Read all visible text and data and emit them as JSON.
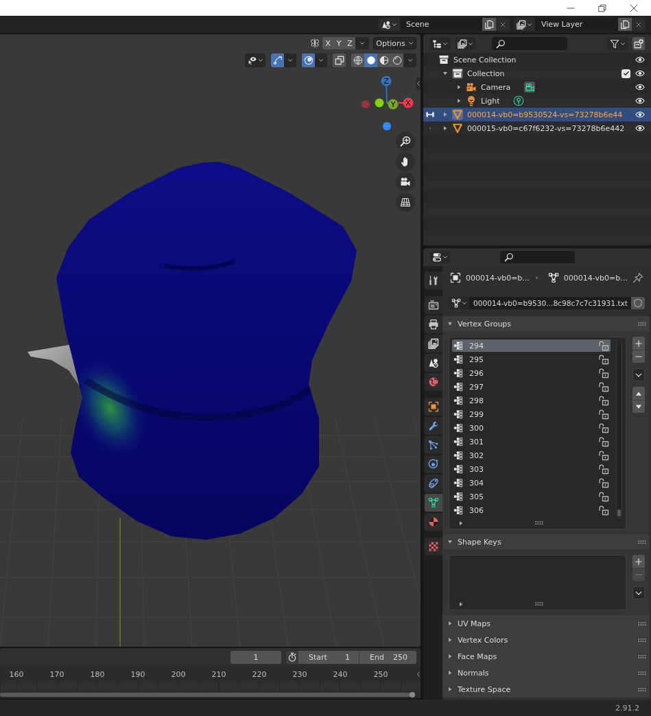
{
  "top_bar": {
    "scene": "Scene",
    "view_layer": "View Layer"
  },
  "viewport": {
    "mirror_axes": [
      {
        "label": "X",
        "selected": false
      },
      {
        "label": "Y",
        "selected": false
      },
      {
        "label": "Z",
        "selected": false
      }
    ],
    "options": "Options",
    "toggles": [
      {
        "kind": "selectability",
        "on": false
      },
      {
        "kind": "gizmos",
        "on": true
      },
      {
        "kind": "overlays",
        "on": true
      },
      {
        "kind": "xray",
        "on": false
      }
    ],
    "shading": [
      {
        "kind": "wireframe",
        "selected": false
      },
      {
        "kind": "solid",
        "selected": true
      },
      {
        "kind": "material",
        "selected": false
      },
      {
        "kind": "rendered",
        "selected": false
      }
    ],
    "gizmo_axes": [
      {
        "kind": "z",
        "label": "Z"
      },
      {
        "kind": "y",
        "label": "Y"
      },
      {
        "kind": "x",
        "label": "X"
      }
    ]
  },
  "timeline": {
    "current_frame": "1",
    "start_label": "Start",
    "start": "1",
    "end_label": "End",
    "end": "250",
    "ruler": [
      "160",
      "170",
      "180",
      "190",
      "200",
      "210",
      "220",
      "230",
      "240",
      "250"
    ]
  },
  "outliner": {
    "tree": [
      {
        "kind": "scene_collection",
        "label": "Scene Collection",
        "selected": false,
        "children": [
          {
            "kind": "collection",
            "label": "Collection",
            "expanded": true,
            "checked": true,
            "selected": false,
            "children": [
              {
                "kind": "camera",
                "label": "Camera",
                "expanded": false,
                "selected": false
              },
              {
                "kind": "light",
                "label": "Light",
                "expanded": false,
                "selected": false
              }
            ]
          },
          {
            "kind": "mesh",
            "label": "000014-vb0=b9530524-vs=73278b6e44",
            "expanded": false,
            "selected": true,
            "in_mode": true
          },
          {
            "kind": "mesh",
            "label": "000015-vb0=c67f6232-vs=73278b6e442",
            "expanded": false,
            "selected": false,
            "in_mode": false
          }
        ]
      }
    ]
  },
  "properties": {
    "tab_groups": [
      [
        {
          "kind": "tool",
          "selected": false
        }
      ],
      [
        {
          "kind": "render",
          "selected": false
        },
        {
          "kind": "output",
          "selected": false
        },
        {
          "kind": "view_layer",
          "selected": false
        },
        {
          "kind": "scene",
          "selected": false
        },
        {
          "kind": "world",
          "selected": false
        }
      ],
      [
        {
          "kind": "object",
          "selected": false
        },
        {
          "kind": "modifiers",
          "selected": false
        },
        {
          "kind": "particles",
          "selected": false
        },
        {
          "kind": "physics",
          "selected": false
        },
        {
          "kind": "constraints",
          "selected": false
        },
        {
          "kind": "data",
          "selected": true
        },
        {
          "kind": "material",
          "selected": false
        }
      ],
      [
        {
          "kind": "texture",
          "selected": false
        }
      ]
    ],
    "breadcrumb": [
      {
        "kind": "object",
        "label": "000014-vb0=b..."
      },
      {
        "kind": "mesh",
        "label": "000014-vb0=b..."
      }
    ],
    "mesh_name": "000014-vb0=b9530...8c98c7c7c31931.txt",
    "panels": [
      {
        "title": "Vertex Groups",
        "expanded": true,
        "items": [
          {
            "name": "294",
            "selected": true,
            "locked": false
          },
          {
            "name": "295",
            "selected": false,
            "locked": false
          },
          {
            "name": "296",
            "selected": false,
            "locked": false
          },
          {
            "name": "297",
            "selected": false,
            "locked": false
          },
          {
            "name": "298",
            "selected": false,
            "locked": false
          },
          {
            "name": "299",
            "selected": false,
            "locked": false
          },
          {
            "name": "300",
            "selected": false,
            "locked": false
          },
          {
            "name": "301",
            "selected": false,
            "locked": false
          },
          {
            "name": "302",
            "selected": false,
            "locked": false
          },
          {
            "name": "303",
            "selected": false,
            "locked": false
          },
          {
            "name": "304",
            "selected": false,
            "locked": false
          },
          {
            "name": "305",
            "selected": false,
            "locked": false
          },
          {
            "name": "306",
            "selected": false,
            "locked": false
          }
        ],
        "buttons": [
          {
            "kind": "add",
            "disabled": false
          },
          {
            "kind": "remove",
            "disabled": false
          },
          {
            "kind": "menu",
            "disabled": false
          },
          {
            "kind": "move_up",
            "disabled": false
          },
          {
            "kind": "move_down",
            "disabled": false
          }
        ]
      },
      {
        "title": "Shape Keys",
        "expanded": true,
        "buttons": [
          {
            "kind": "add",
            "disabled": false
          },
          {
            "kind": "remove",
            "disabled": true
          },
          {
            "kind": "menu",
            "disabled": false
          }
        ]
      },
      {
        "title": "UV Maps",
        "expanded": false
      },
      {
        "title": "Vertex Colors",
        "expanded": false
      },
      {
        "title": "Face Maps",
        "expanded": false
      },
      {
        "title": "Normals",
        "expanded": false
      },
      {
        "title": "Texture Space",
        "expanded": false
      }
    ]
  },
  "status_bar": {
    "version": "2.91.2"
  }
}
